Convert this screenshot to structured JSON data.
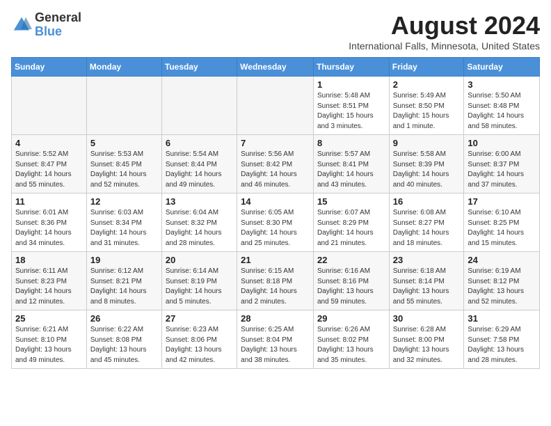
{
  "header": {
    "logo_line1": "General",
    "logo_line2": "Blue",
    "month_year": "August 2024",
    "location": "International Falls, Minnesota, United States"
  },
  "days_of_week": [
    "Sunday",
    "Monday",
    "Tuesday",
    "Wednesday",
    "Thursday",
    "Friday",
    "Saturday"
  ],
  "weeks": [
    [
      {
        "day": "",
        "info": "",
        "empty": true
      },
      {
        "day": "",
        "info": "",
        "empty": true
      },
      {
        "day": "",
        "info": "",
        "empty": true
      },
      {
        "day": "",
        "info": "",
        "empty": true
      },
      {
        "day": "1",
        "info": "Sunrise: 5:48 AM\nSunset: 8:51 PM\nDaylight: 15 hours\nand 3 minutes."
      },
      {
        "day": "2",
        "info": "Sunrise: 5:49 AM\nSunset: 8:50 PM\nDaylight: 15 hours\nand 1 minute."
      },
      {
        "day": "3",
        "info": "Sunrise: 5:50 AM\nSunset: 8:48 PM\nDaylight: 14 hours\nand 58 minutes."
      }
    ],
    [
      {
        "day": "4",
        "info": "Sunrise: 5:52 AM\nSunset: 8:47 PM\nDaylight: 14 hours\nand 55 minutes."
      },
      {
        "day": "5",
        "info": "Sunrise: 5:53 AM\nSunset: 8:45 PM\nDaylight: 14 hours\nand 52 minutes."
      },
      {
        "day": "6",
        "info": "Sunrise: 5:54 AM\nSunset: 8:44 PM\nDaylight: 14 hours\nand 49 minutes."
      },
      {
        "day": "7",
        "info": "Sunrise: 5:56 AM\nSunset: 8:42 PM\nDaylight: 14 hours\nand 46 minutes."
      },
      {
        "day": "8",
        "info": "Sunrise: 5:57 AM\nSunset: 8:41 PM\nDaylight: 14 hours\nand 43 minutes."
      },
      {
        "day": "9",
        "info": "Sunrise: 5:58 AM\nSunset: 8:39 PM\nDaylight: 14 hours\nand 40 minutes."
      },
      {
        "day": "10",
        "info": "Sunrise: 6:00 AM\nSunset: 8:37 PM\nDaylight: 14 hours\nand 37 minutes."
      }
    ],
    [
      {
        "day": "11",
        "info": "Sunrise: 6:01 AM\nSunset: 8:36 PM\nDaylight: 14 hours\nand 34 minutes."
      },
      {
        "day": "12",
        "info": "Sunrise: 6:03 AM\nSunset: 8:34 PM\nDaylight: 14 hours\nand 31 minutes."
      },
      {
        "day": "13",
        "info": "Sunrise: 6:04 AM\nSunset: 8:32 PM\nDaylight: 14 hours\nand 28 minutes."
      },
      {
        "day": "14",
        "info": "Sunrise: 6:05 AM\nSunset: 8:30 PM\nDaylight: 14 hours\nand 25 minutes."
      },
      {
        "day": "15",
        "info": "Sunrise: 6:07 AM\nSunset: 8:29 PM\nDaylight: 14 hours\nand 21 minutes."
      },
      {
        "day": "16",
        "info": "Sunrise: 6:08 AM\nSunset: 8:27 PM\nDaylight: 14 hours\nand 18 minutes."
      },
      {
        "day": "17",
        "info": "Sunrise: 6:10 AM\nSunset: 8:25 PM\nDaylight: 14 hours\nand 15 minutes."
      }
    ],
    [
      {
        "day": "18",
        "info": "Sunrise: 6:11 AM\nSunset: 8:23 PM\nDaylight: 14 hours\nand 12 minutes."
      },
      {
        "day": "19",
        "info": "Sunrise: 6:12 AM\nSunset: 8:21 PM\nDaylight: 14 hours\nand 8 minutes."
      },
      {
        "day": "20",
        "info": "Sunrise: 6:14 AM\nSunset: 8:19 PM\nDaylight: 14 hours\nand 5 minutes."
      },
      {
        "day": "21",
        "info": "Sunrise: 6:15 AM\nSunset: 8:18 PM\nDaylight: 14 hours\nand 2 minutes."
      },
      {
        "day": "22",
        "info": "Sunrise: 6:16 AM\nSunset: 8:16 PM\nDaylight: 13 hours\nand 59 minutes."
      },
      {
        "day": "23",
        "info": "Sunrise: 6:18 AM\nSunset: 8:14 PM\nDaylight: 13 hours\nand 55 minutes."
      },
      {
        "day": "24",
        "info": "Sunrise: 6:19 AM\nSunset: 8:12 PM\nDaylight: 13 hours\nand 52 minutes."
      }
    ],
    [
      {
        "day": "25",
        "info": "Sunrise: 6:21 AM\nSunset: 8:10 PM\nDaylight: 13 hours\nand 49 minutes."
      },
      {
        "day": "26",
        "info": "Sunrise: 6:22 AM\nSunset: 8:08 PM\nDaylight: 13 hours\nand 45 minutes."
      },
      {
        "day": "27",
        "info": "Sunrise: 6:23 AM\nSunset: 8:06 PM\nDaylight: 13 hours\nand 42 minutes."
      },
      {
        "day": "28",
        "info": "Sunrise: 6:25 AM\nSunset: 8:04 PM\nDaylight: 13 hours\nand 38 minutes."
      },
      {
        "day": "29",
        "info": "Sunrise: 6:26 AM\nSunset: 8:02 PM\nDaylight: 13 hours\nand 35 minutes."
      },
      {
        "day": "30",
        "info": "Sunrise: 6:28 AM\nSunset: 8:00 PM\nDaylight: 13 hours\nand 32 minutes."
      },
      {
        "day": "31",
        "info": "Sunrise: 6:29 AM\nSunset: 7:58 PM\nDaylight: 13 hours\nand 28 minutes."
      }
    ]
  ]
}
